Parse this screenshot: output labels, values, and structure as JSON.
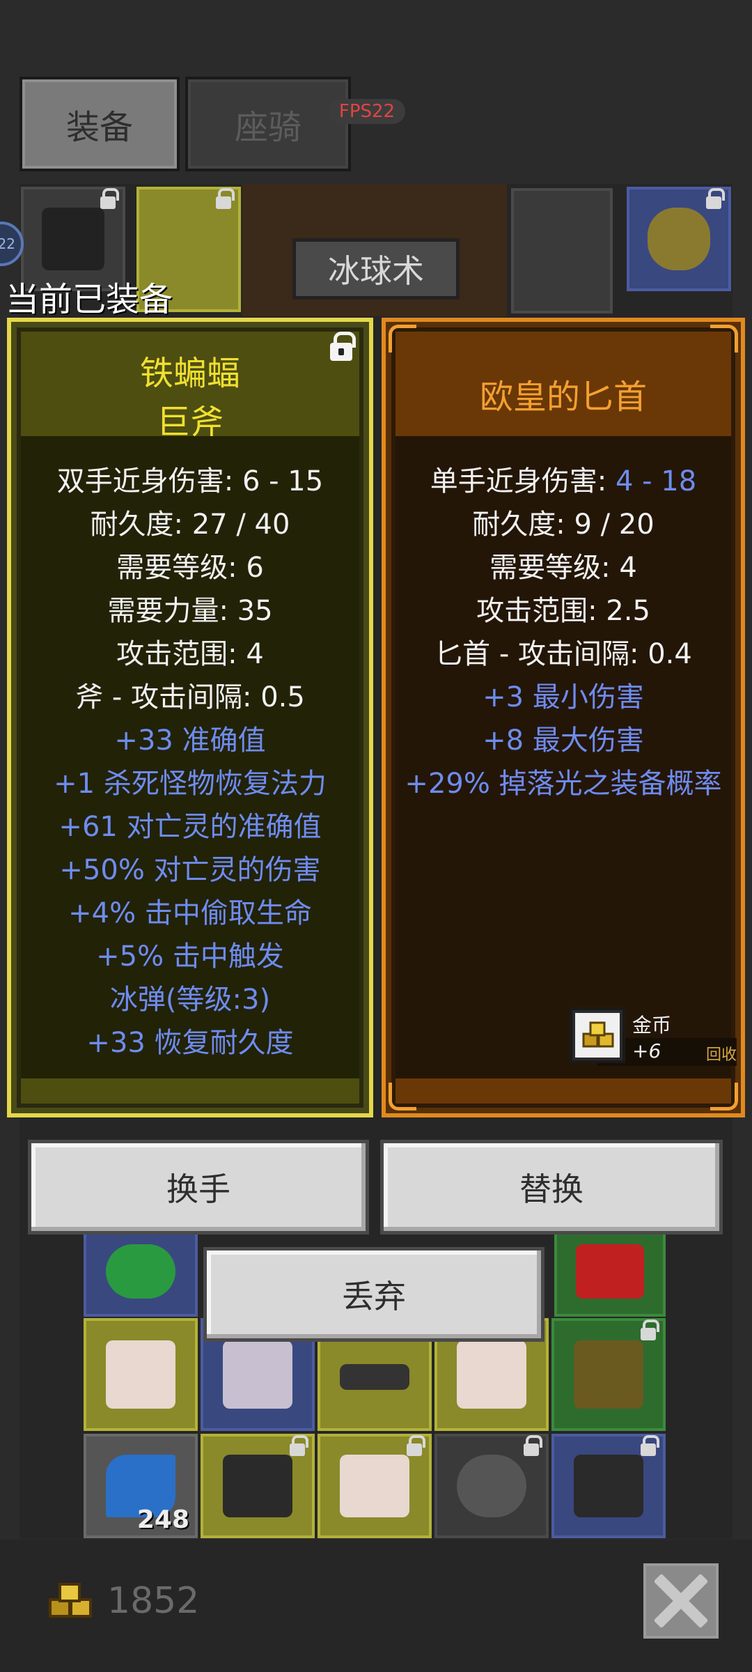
{
  "tabs": {
    "equip": "装备",
    "mount": "座骑"
  },
  "fps": "FPS22",
  "skill_banner": "冰球术",
  "side_badge": "22",
  "equipped_label": "当前已装备",
  "left_item": {
    "name_line1": "铁蝙蝠",
    "name_line2": "巨斧",
    "locked": true,
    "stats": [
      {
        "text": "双手近身伤害: 6 - 15",
        "kind": "base"
      },
      {
        "text": "耐久度: 27 / 40",
        "kind": "base"
      },
      {
        "text": "需要等级: 6",
        "kind": "base"
      },
      {
        "text": "需要力量: 35",
        "kind": "base"
      },
      {
        "text": "攻击范围: 4",
        "kind": "base"
      },
      {
        "text": "斧 - 攻击间隔: 0.5",
        "kind": "base"
      },
      {
        "text": "+33 准确值",
        "kind": "magic"
      },
      {
        "text": "+1 杀死怪物恢复法力",
        "kind": "magic"
      },
      {
        "text": "+61 对亡灵的准确值",
        "kind": "magic"
      },
      {
        "text": "+50% 对亡灵的伤害",
        "kind": "magic"
      },
      {
        "text": "+4% 击中偷取生命",
        "kind": "magic"
      },
      {
        "text": "+5% 击中触发",
        "kind": "magic"
      },
      {
        "text": "冰弹(等级:3)",
        "kind": "magic"
      },
      {
        "text": "+33 恢复耐久度",
        "kind": "magic"
      }
    ]
  },
  "right_item": {
    "name": "欧皇的匕首",
    "damage_label": "单手近身伤害: ",
    "damage_value": "4 - 18",
    "stats": [
      {
        "text": "耐久度: 9 / 20",
        "kind": "base"
      },
      {
        "text": "需要等级: 4",
        "kind": "base"
      },
      {
        "text": "攻击范围: 2.5",
        "kind": "base"
      },
      {
        "text": "匕首 - 攻击间隔: 0.4",
        "kind": "base"
      },
      {
        "text": "+3 最小伤害",
        "kind": "magic"
      },
      {
        "text": "+8 最大伤害",
        "kind": "magic"
      },
      {
        "text": "+29% 掉落光之装备概率",
        "kind": "magic"
      }
    ],
    "recycle": {
      "currency": "金币",
      "amount": "+6",
      "action": "回收"
    }
  },
  "buttons": {
    "swap_hands": "换手",
    "replace": "替换",
    "discard": "丢弃"
  },
  "inventory": {
    "stack_count": "248"
  },
  "footer": {
    "gold": "1852"
  },
  "colors": {
    "unique_yellow": "#f0e030",
    "legend_orange": "#f4a030",
    "magic_blue": "#6e8cf0",
    "fps_red": "#e04444"
  },
  "icons": [
    "lock-icon",
    "gold-coins-icon",
    "close-icon",
    "item-sprite"
  ]
}
